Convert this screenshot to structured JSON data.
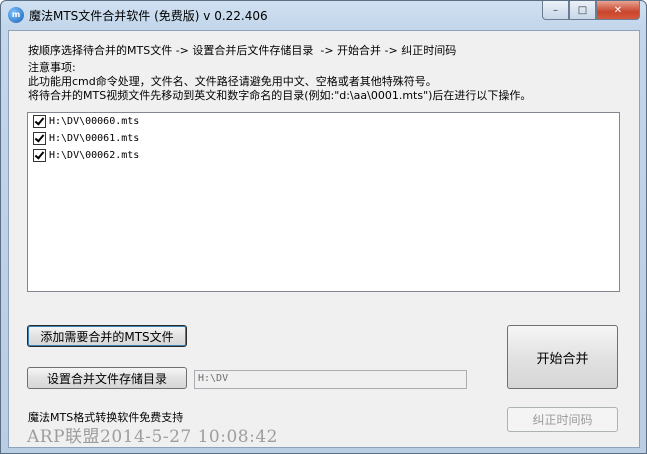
{
  "window": {
    "title": "魔法MTS文件合并软件 (免费版) v 0.22.406",
    "icon": "app-logo-icon",
    "minimize_glyph": "–",
    "maximize_glyph": "□",
    "close_glyph": "✕"
  },
  "instructions": {
    "steps": "按顺序选择待合并的MTS文件 -> 设置合并后文件存储目录  -> 开始合并 -> 纠正时间码",
    "notes_title": "注意事项:",
    "note_1": "此功能用cmd命令处理，文件名、文件路径请避免用中文、空格或者其他特殊符号。",
    "note_2": "将待合并的MTS视频文件先移动到英文和数字命名的目录(例如:\"d:\\aa\\0001.mts\")后在进行以下操作。"
  },
  "files": [
    {
      "name": "H:\\DV\\00060.mts",
      "checked": true
    },
    {
      "name": "H:\\DV\\00061.mts",
      "checked": true
    },
    {
      "name": "H:\\DV\\00062.mts",
      "checked": true
    }
  ],
  "buttons": {
    "add_files": "添加需要合并的MTS文件",
    "set_output_dir": "设置合并文件存储目录",
    "start_merge": "开始合并",
    "fix_timecode": "纠正时间码"
  },
  "output_dir": {
    "value": "H:\\DV"
  },
  "footer": {
    "support_text": "魔法MTS格式转换软件免费支持",
    "watermark": "ARP联盟2014-5-27 10:08:42"
  }
}
